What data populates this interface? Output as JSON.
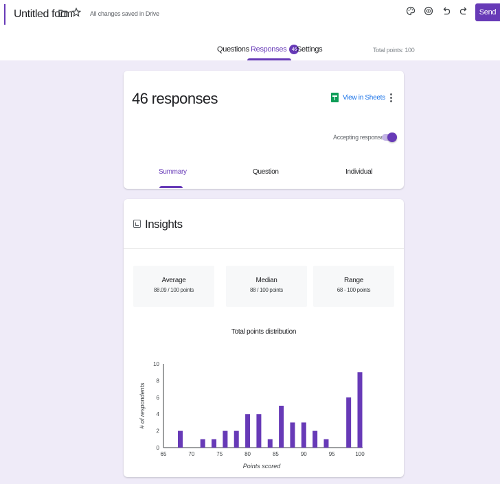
{
  "header": {
    "form_title": "Untitled form",
    "save_status": "All changes saved in Drive",
    "send_label": "Send",
    "icons": [
      "folder-icon",
      "star-icon",
      "palette-icon",
      "preview-eye-icon",
      "undo-icon",
      "redo-icon"
    ]
  },
  "tabs": {
    "questions": "Questions",
    "responses": "Responses",
    "responses_count": "46",
    "settings": "Settings",
    "total_points": "Total points: 100"
  },
  "responses": {
    "count_text": "46 responses",
    "view_in_sheets": "View in Sheets",
    "accepting_label": "Accepting responses",
    "accepting": true,
    "sub_tabs": [
      "Summary",
      "Question",
      "Individual"
    ],
    "active_sub_tab": "Summary"
  },
  "insights": {
    "title": "Insights",
    "stats": [
      {
        "label": "Average",
        "value": "88.09 / 100 points"
      },
      {
        "label": "Median",
        "value": "88 / 100 points"
      },
      {
        "label": "Range",
        "value": "68 - 100 points"
      }
    ]
  },
  "colors": {
    "accent": "#673ab7",
    "background": "#efebf8",
    "bar": "#673ab7",
    "link": "#1a73e8",
    "sheets": "#0f9d58"
  },
  "chart_data": {
    "type": "bar",
    "title": "Total points distribution",
    "xlabel": "Points scored",
    "ylabel": "# of respondents",
    "xlim": [
      65,
      100
    ],
    "ylim": [
      0,
      10
    ],
    "xticks": [
      65,
      70,
      75,
      80,
      85,
      90,
      95,
      100
    ],
    "yticks": [
      0,
      2,
      4,
      6,
      8,
      10
    ],
    "x": [
      68,
      72,
      74,
      76,
      78,
      80,
      82,
      84,
      86,
      88,
      90,
      92,
      94,
      98,
      100
    ],
    "values": [
      2,
      1,
      1,
      2,
      2,
      4,
      4,
      1,
      5,
      3,
      3,
      2,
      1,
      6,
      9
    ],
    "grid": false
  }
}
